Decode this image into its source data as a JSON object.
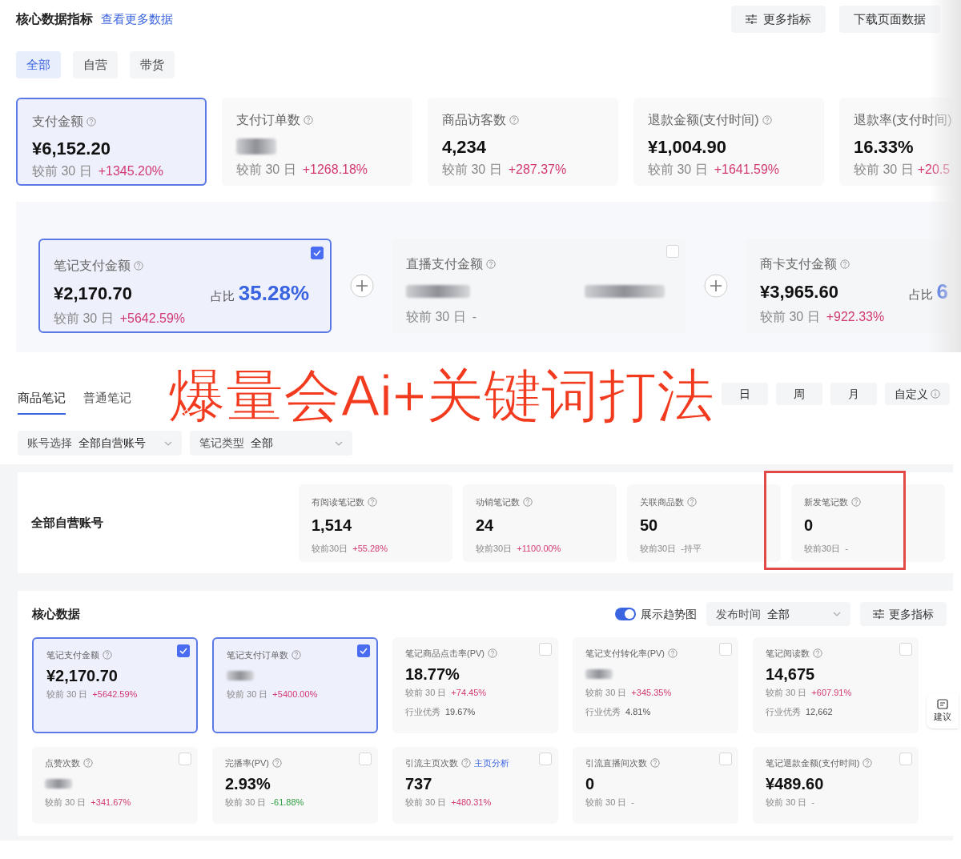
{
  "header": {
    "title": "核心数据指标",
    "link": "查看更多数据",
    "buttons": [
      {
        "label": "更多指标",
        "kind": "filter"
      },
      {
        "label": "下载页面数据",
        "kind": "plain"
      }
    ]
  },
  "scope_tabs": [
    {
      "label": "全部",
      "selected": true
    },
    {
      "label": "自营",
      "selected": false
    },
    {
      "label": "带货",
      "selected": false
    }
  ],
  "metric_cards": [
    {
      "label": "支付金额",
      "value": "¥6,152.20",
      "blurred": false,
      "compare": "较前 30 日",
      "change": "+1345.20%",
      "color": "#d23a72",
      "selected": true
    },
    {
      "label": "支付订单数",
      "blurred": true,
      "compare": "较前 30 日",
      "change": "+1268.18%",
      "color": "#d23a72",
      "selected": false
    },
    {
      "label": "商品访客数",
      "value": "4,234",
      "blurred": false,
      "compare": "较前 30 日",
      "change": "+287.37%",
      "color": "#d23a72",
      "selected": false
    },
    {
      "label": "退款金额(支付时间)",
      "value": "¥1,004.90",
      "blurred": false,
      "compare": "较前 30 日",
      "change": "+1641.59%",
      "color": "#d23a72",
      "selected": false
    },
    {
      "label": "退款率(支付时间)",
      "value": "16.33%",
      "blurred": false,
      "compare": "较前 30 日",
      "change": "+20.5",
      "color": "#d23a72",
      "selected": false
    }
  ],
  "channel_cards": [
    {
      "label": "笔记支付金额",
      "value": "¥2,170.70",
      "blurred": false,
      "share_label": "占比",
      "share": "35.28%",
      "compare": "较前 30 日",
      "change": "+5642.59%",
      "color": "#d23a72",
      "selected": true,
      "checked": true
    },
    {
      "label": "直播支付金额",
      "blurred": true,
      "compare": "较前 30 日",
      "change": "-",
      "color": "#888888",
      "selected": false,
      "checked": false
    },
    {
      "label": "商卡支付金额",
      "value": "¥3,965.60",
      "blurred": false,
      "share_label": "占比",
      "share": "6",
      "compare": "较前 30 日",
      "change": "+922.33%",
      "color": "#d23a72",
      "selected": false
    }
  ],
  "note_tabs": [
    {
      "label": "商品笔记",
      "selected": true
    },
    {
      "label": "普通笔记",
      "selected": false
    }
  ],
  "period_buttons": [
    {
      "label": "日",
      "selected": false
    },
    {
      "label": "周",
      "selected": false
    },
    {
      "label": "月",
      "selected": false
    },
    {
      "label": "自定义",
      "selected": false,
      "info": true
    }
  ],
  "filters": [
    {
      "label": "账号选择",
      "value": "全部自营账号"
    },
    {
      "label": "笔记类型",
      "value": "全部"
    }
  ],
  "account_summary": {
    "title": "全部自营账号",
    "stats": [
      {
        "label": "有阅读笔记数",
        "value": "1,514",
        "compare": "较前30日",
        "change": "+55.28%",
        "color": "#d23a72",
        "highlighted": false
      },
      {
        "label": "动销笔记数",
        "value": "24",
        "compare": "较前30日",
        "change": "+1100.00%",
        "color": "#d23a72",
        "highlighted": false
      },
      {
        "label": "关联商品数",
        "value": "50",
        "compare": "较前30日",
        "change": "-持平",
        "color": "#888888",
        "highlighted": false
      },
      {
        "label": "新发笔记数",
        "value": "0",
        "compare": "较前30日",
        "change": "-",
        "highlighted": true
      }
    ]
  },
  "core_data": {
    "title": "核心数据",
    "trend_toggle": {
      "label": "展示趋势图",
      "on": true
    },
    "filter": {
      "label": "发布时间",
      "value": "全部"
    },
    "button": "更多指标",
    "cards": [
      {
        "label": "笔记支付金额",
        "value": "¥2,170.70",
        "blurred": false,
        "compare": "较前 30 日",
        "change": "+5642.59%",
        "color": "#d23a72",
        "checked": true
      },
      {
        "label": "笔记支付订单数",
        "blurred": true,
        "compare": "较前 30 日",
        "change": "+5400.00%",
        "color": "#d23a72",
        "checked": true
      },
      {
        "label": "笔记商品点击率(PV)",
        "value": "18.77%",
        "blurred": false,
        "compare": "较前 30 日",
        "change": "+74.45%",
        "color": "#d23a72",
        "industry_label": "行业优秀",
        "industry_value": "19.67%",
        "checked": false
      },
      {
        "label": "笔记支付转化率(PV)",
        "blurred": true,
        "compare": "较前 30 日",
        "change": "+345.35%",
        "color": "#d23a72",
        "industry_label": "行业优秀",
        "industry_value": "4.81%",
        "checked": false
      },
      {
        "label": "笔记阅读数",
        "value": "14,675",
        "blurred": false,
        "compare": "较前 30 日",
        "change": "+607.91%",
        "color": "#d23a72",
        "industry_label": "行业优秀",
        "industry_value": "12,662",
        "checked": false
      },
      {
        "label": "点赞次数",
        "blurred": true,
        "compare": "较前 30 日",
        "change": "+341.67%",
        "color": "#d23a72",
        "checked": false
      },
      {
        "label": "完播率(PV)",
        "value": "2.93%",
        "blurred": false,
        "compare": "较前 30 日",
        "change": "-61.88%",
        "color": "#2e9e3f",
        "checked": false
      },
      {
        "label": "引流主页次数",
        "link": "主页分析",
        "value": "737",
        "blurred": false,
        "compare": "较前 30 日",
        "change": "+480.31%",
        "color": "#d23a72",
        "checked": false
      },
      {
        "label": "引流直播间次数",
        "value": "0",
        "blurred": false,
        "compare": "较前 30 日",
        "change": "-",
        "checked": false
      },
      {
        "label": "笔记退款金额(支付时间)",
        "value": "¥489.60",
        "blurred": false,
        "compare": "较前 30 日",
        "change": "-",
        "checked": false
      }
    ]
  },
  "feedback_tab": "建议",
  "overlay_caption": "爆量会Ai+关键词打法"
}
